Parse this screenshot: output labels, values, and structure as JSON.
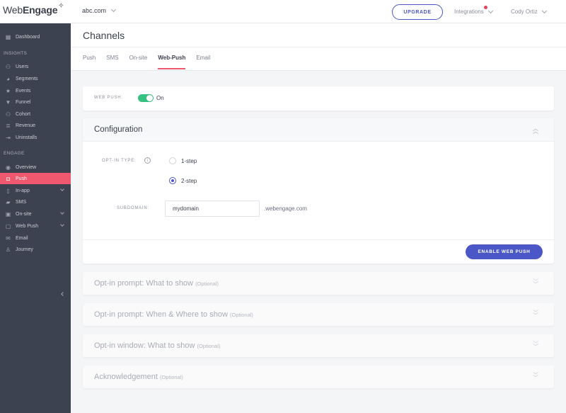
{
  "brand": {
    "logo_prefix": "Web",
    "logo_suffix": "Engage",
    "accent": "#f0586f",
    "primary": "#4b57c6",
    "toggle_on": "#37c082"
  },
  "topbar": {
    "account": "abc.com",
    "upgrade_label": "UPGRADE",
    "integrations_label": "Integrations",
    "user_name": "Cody Ortiz"
  },
  "sidebar": {
    "dashboard": "Dashboard",
    "insights_label": "INSIGHTS",
    "insights": [
      "Users",
      "Segments",
      "Events",
      "Funnel",
      "Cohort",
      "Revenue",
      "Uninstalls"
    ],
    "engage_label": "ENGAGE",
    "engage": [
      "Overview",
      "Push",
      "In-app",
      "SMS",
      "On-site",
      "Web Push",
      "Email",
      "Journey"
    ],
    "active_item": "Push"
  },
  "page": {
    "title": "Channels",
    "tabs": [
      "Push",
      "SMS",
      "On-site",
      "Web-Push",
      "Email"
    ],
    "active_tab": "Web-Push"
  },
  "webpush": {
    "label": "WEB PUSH:",
    "state": "On",
    "enabled": true
  },
  "configuration": {
    "title": "Configuration",
    "optin_label": "OPT-IN TYPE:",
    "option_1": "1-step",
    "option_2": "2-step",
    "selected": "2-step",
    "subdomain_label": "SUBDOMAIN:",
    "subdomain_value": "mydomain",
    "subdomain_suffix": ".webengage.com",
    "enable_button": "ENABLE WEB PUSH"
  },
  "accordions": [
    {
      "title": "Opt-in prompt: What to show",
      "note": "(Optional)"
    },
    {
      "title": "Opt-in prompt: When & Where to show",
      "note": "(Optional)"
    },
    {
      "title": "Opt-in window: What to show",
      "note": "(Optional)"
    },
    {
      "title": "Acknowledgement",
      "note": "(Optional)"
    }
  ]
}
